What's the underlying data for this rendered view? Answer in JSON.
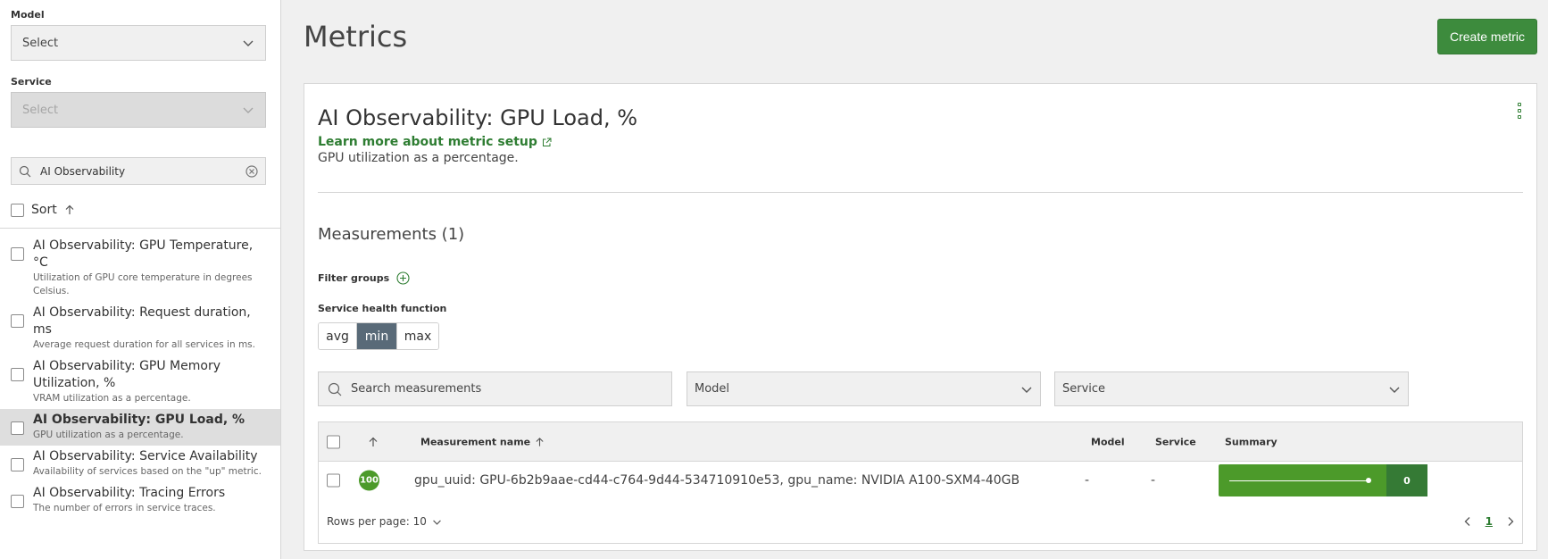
{
  "sidebar": {
    "model_label": "Model",
    "model_value": "Select",
    "service_label": "Service",
    "service_value": "Select",
    "search_value": "AI Observability",
    "sort_label": "Sort",
    "metrics": [
      {
        "title": "AI Observability: GPU Temperature, °C",
        "desc_line1": "Utilization of GPU core temperature in degrees",
        "desc_line2": "Celsius.",
        "selected": false
      },
      {
        "title": "AI Observability: Request duration, ms",
        "desc_line1": "Average request duration for all services in ms.",
        "selected": false
      },
      {
        "title_line1": "AI Observability: GPU Memory",
        "title_line2": "Utilization, %",
        "desc_line1": "VRAM utilization as a percentage.",
        "selected": false
      },
      {
        "title": "AI Observability: GPU Load, %",
        "desc_line1": "GPU utilization as a percentage.",
        "selected": true
      },
      {
        "title": "AI Observability: Service Availability",
        "desc_line1": "Availability of services based on the \"up\" metric.",
        "selected": false
      },
      {
        "title": "AI Observability: Tracing Errors",
        "desc_line1": "The number of errors in service traces.",
        "selected": false
      }
    ]
  },
  "header": {
    "title": "Metrics",
    "create_label": "Create metric"
  },
  "card": {
    "title": "AI Observability: GPU Load, %",
    "learn_link": "Learn more about metric setup",
    "description": "GPU utilization as a percentage.",
    "measurements_title": "Measurements (1)",
    "filter_groups_label": "Filter groups",
    "health_label": "Service health function",
    "health_options": [
      "avg",
      "min",
      "max"
    ],
    "health_selected": "min",
    "search_placeholder": "Search measurements",
    "model_filter": "Model",
    "service_filter": "Service"
  },
  "table": {
    "columns": {
      "name": "Measurement name",
      "model": "Model",
      "service": "Service",
      "summary": "Summary"
    },
    "rows": [
      {
        "score": "100",
        "name": "gpu_uuid: GPU-6b2b9aae-cd44-c764-9d44-534710910e53, gpu_name: NVIDIA A100-SXM4-40GB",
        "model": "-",
        "service": "-",
        "summary_value": "0"
      }
    ],
    "rows_per_page_label": "Rows per page: 10",
    "current_page": "1"
  },
  "colors": {
    "primary_green": "#3d8b3d",
    "score_green": "#4c9a2a",
    "segment_active": "#596a78"
  }
}
